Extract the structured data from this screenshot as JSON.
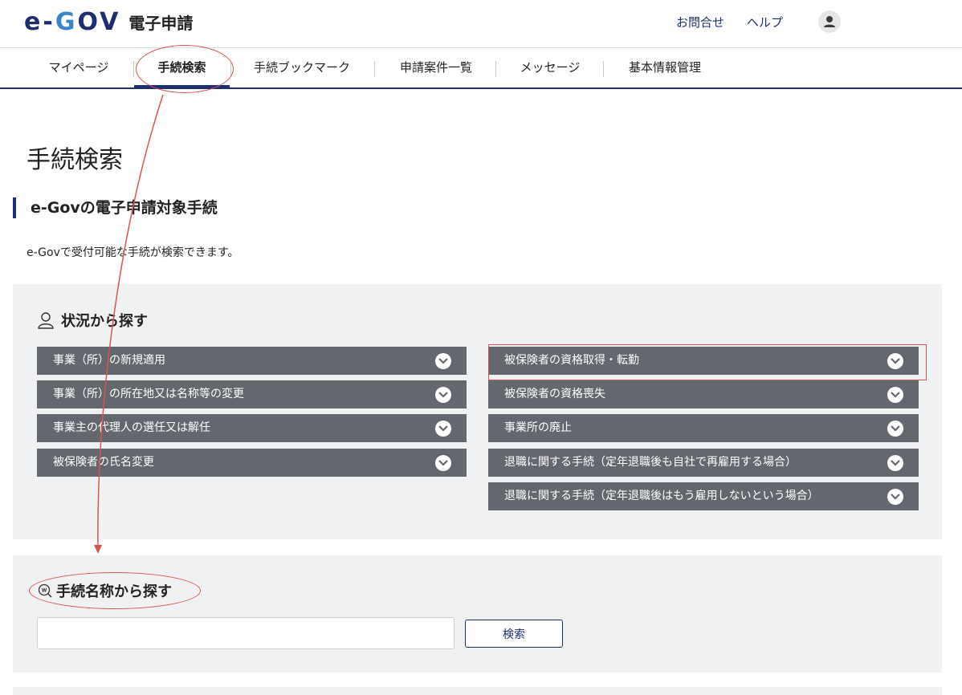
{
  "header": {
    "logo_mark": "e-GOV",
    "logo_text": "電子申請",
    "contact_label": "お問合せ",
    "help_label": "ヘルプ"
  },
  "nav": {
    "items": [
      {
        "label": "マイページ"
      },
      {
        "label": "手続検索",
        "active": true
      },
      {
        "label": "手続ブックマーク"
      },
      {
        "label": "申請案件一覧"
      },
      {
        "label": "メッセージ"
      },
      {
        "label": "基本情報管理"
      }
    ]
  },
  "page": {
    "title": "手続検索",
    "section_title": "e-Govの電子申請対象手続",
    "description": "e-Govで受付可能な手続が検索できます。"
  },
  "situation": {
    "title": "状況から探す",
    "left_items": [
      "事業（所）の新規適用",
      "事業（所）の所在地又は名称等の変更",
      "事業主の代理人の選任又は解任",
      "被保険者の氏名変更"
    ],
    "right_items": [
      "被保険者の資格取得・転勤",
      "被保険者の資格喪失",
      "事業所の廃止",
      "退職に関する手続（定年退職後も自社で再雇用する場合）",
      "退職に関する手続（定年退職後はもう雇用しないという場合）"
    ]
  },
  "name_search": {
    "title": "手続名称から探す",
    "input_value": "",
    "input_placeholder": "",
    "button_label": "検索"
  },
  "colors": {
    "brand": "#1d2f6f",
    "accent": "#3a86c8",
    "button_bg": "#64676e",
    "panel_bg": "#f0f1f3",
    "annotation": "#d9534f"
  },
  "icons": {
    "user": "user-icon",
    "situation": "person-outline-icon",
    "search": "search-icon",
    "chevron": "chevron-down-circle-icon"
  }
}
